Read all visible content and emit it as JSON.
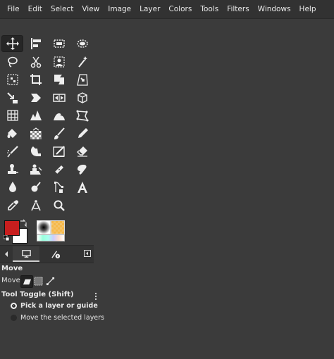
{
  "menubar": {
    "items": [
      "File",
      "Edit",
      "Select",
      "View",
      "Image",
      "Layer",
      "Colors",
      "Tools",
      "Filters",
      "Windows",
      "Help"
    ]
  },
  "toolbox": {
    "tools": [
      "move-tool",
      "align-tool",
      "rect-select-tool",
      "ellipse-select-tool",
      "free-select-tool",
      "scissors-select-tool",
      "foreground-select-tool",
      "fuzzy-select-tool",
      "by-color-select-tool",
      "crop-tool",
      "transform-tool",
      "perspective-tool",
      "unified-transform-tool",
      "shear-tool",
      "flip-tool",
      "3d-transform-tool",
      "cage-transform-tool",
      "warp-transform-tool",
      "handle-transform-tool",
      "perspective-clone-tool",
      "bucket-fill-tool",
      "gradient-tool",
      "paintbrush-tool",
      "pencil-tool",
      "airbrush-tool",
      "smudge-tool",
      "mypaint-brush-tool",
      "eraser-tool",
      "clone-tool",
      "heal-tool",
      "dodge-burn-tool",
      "ink-tool",
      "blur-tool",
      "dodge-tool",
      "paths-tool",
      "text-tool",
      "color-picker-tool",
      "measure-tool",
      "zoom-tool"
    ],
    "active_tool": "move-tool"
  },
  "colors": {
    "foreground": "#c81e1e",
    "background": "#ffffff"
  },
  "tool_options": {
    "title": "Move",
    "move_label": "Move:",
    "toggle_label": "Tool Toggle  (Shift)",
    "options": [
      {
        "label": "Pick a layer or guide",
        "selected": true
      },
      {
        "label": "Move the selected layers",
        "selected": false
      }
    ]
  }
}
